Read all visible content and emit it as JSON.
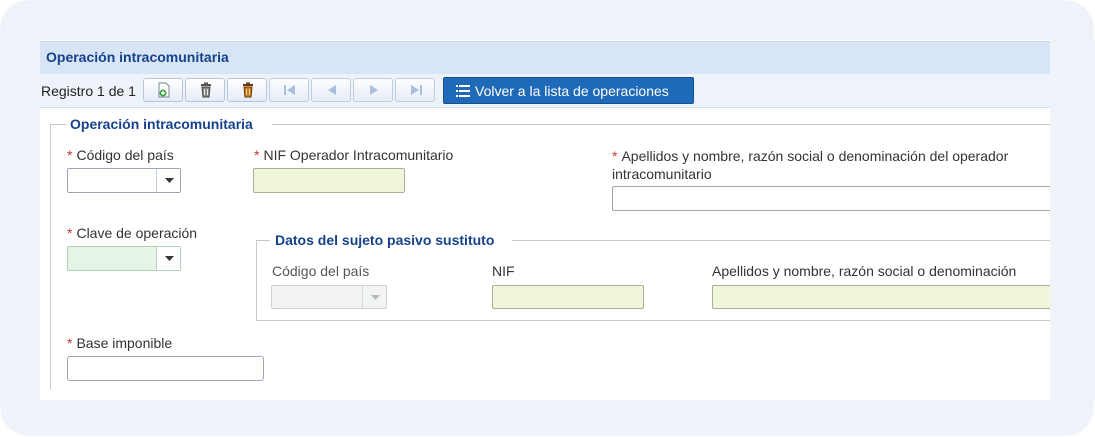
{
  "panel": {
    "title": "Operación intracomunitaria"
  },
  "toolbar": {
    "record_label": "Registro 1 de 1",
    "back_label": "Volver a la lista de operaciones"
  },
  "form": {
    "legend": "Operación intracomunitaria",
    "required_mark": "*",
    "country_code": {
      "label": "Código del país",
      "value": ""
    },
    "nif_operator": {
      "label": "NIF Operador Intracomunitario",
      "value": ""
    },
    "operator_name": {
      "label": "Apellidos y nombre, razón social o denominación del operador intracomunitario",
      "value": ""
    },
    "operation_key": {
      "label": "Clave de operación",
      "value": ""
    },
    "tax_base": {
      "label": "Base imponible",
      "value": ""
    }
  },
  "substitute": {
    "legend": "Datos del sujeto pasivo sustituto",
    "country_code": {
      "label": "Código del país",
      "value": ""
    },
    "nif": {
      "label": "NIF",
      "value": ""
    },
    "name": {
      "label": "Apellidos y nombre, razón social o denominación",
      "value": ""
    }
  },
  "colors": {
    "accent": "#15428b",
    "button": "#1f6ab8",
    "required": "#c0392b",
    "field_yellow": "#f0f6d9",
    "field_green": "#e6f4e6"
  },
  "icons": [
    "new-record-icon",
    "delete-icon",
    "delete-all-icon",
    "first-icon",
    "previous-icon",
    "next-icon",
    "last-icon",
    "list-icon",
    "dropdown-arrow-icon"
  ]
}
